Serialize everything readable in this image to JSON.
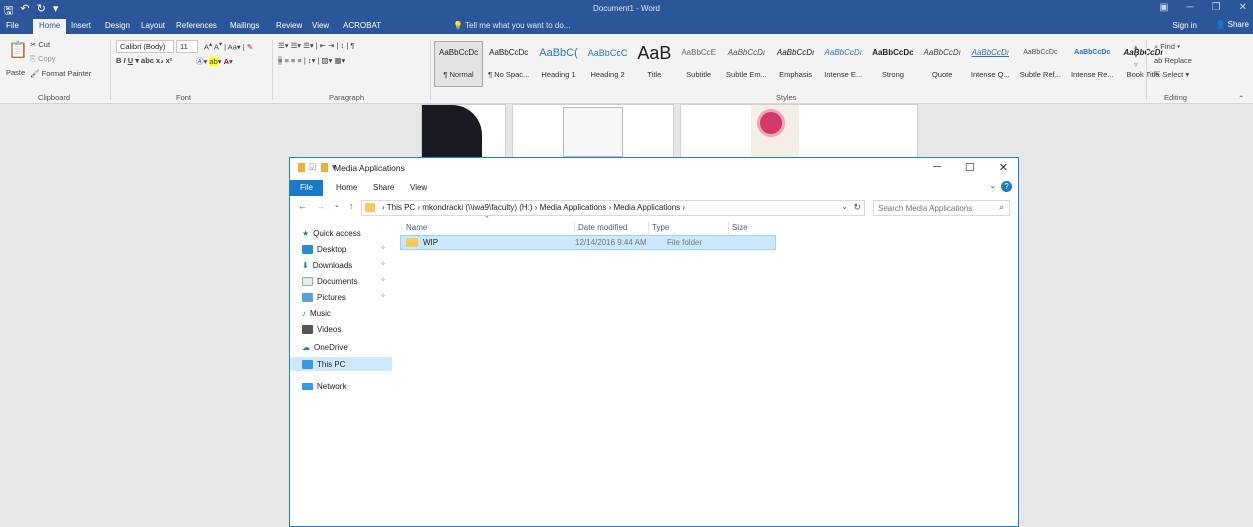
{
  "word": {
    "qat": [
      "save-icon",
      "undo-icon",
      "redo-icon",
      "customize-icon"
    ],
    "doc_title": "Document1 - Word",
    "tabs": [
      "File",
      "Home",
      "Insert",
      "Design",
      "Layout",
      "References",
      "Mailings",
      "Review",
      "View",
      "ACROBAT"
    ],
    "active_tab": "Home",
    "tell_me": "Tell me what you want to do...",
    "sign_in": "Sign in",
    "share": "Share",
    "ribbon": {
      "clipboard": {
        "paste": "Paste",
        "cut": "Cut",
        "copy": "Copy",
        "format_painter": "Format Painter",
        "label": "Clipboard"
      },
      "font": {
        "family": "Calibri (Body)",
        "size": "11",
        "label": "Font"
      },
      "paragraph": {
        "label": "Paragraph"
      },
      "styles": {
        "label": "Styles",
        "items": [
          {
            "sample": "AaBbCcDc",
            "name": "¶ Normal"
          },
          {
            "sample": "AaBbCcDc",
            "name": "¶ No Spac..."
          },
          {
            "sample": "AaBbC(",
            "name": "Heading 1"
          },
          {
            "sample": "AaBbCcC",
            "name": "Heading 2"
          },
          {
            "sample": "AaB",
            "name": "Title"
          },
          {
            "sample": "AaBbCcE",
            "name": "Subtitle"
          },
          {
            "sample": "AaBbCcDı",
            "name": "Subtle Em..."
          },
          {
            "sample": "AaBbCcDı",
            "name": "Emphasis"
          },
          {
            "sample": "AaBbCcDı",
            "name": "Intense E..."
          },
          {
            "sample": "AaBbCcDc",
            "name": "Strong"
          },
          {
            "sample": "AaBbCcDı",
            "name": "Quote"
          },
          {
            "sample": "AaBbCcDı",
            "name": "Intense Q..."
          },
          {
            "sample": "AaBbCcDc",
            "name": "Subtle Ref..."
          },
          {
            "sample": "AaBbCcDc",
            "name": "Intense Re..."
          },
          {
            "sample": "AaBbCcDı",
            "name": "Book Title"
          }
        ]
      },
      "editing": {
        "find": "Find",
        "replace": "Replace",
        "select": "Select",
        "label": "Editing"
      }
    }
  },
  "explorer": {
    "title": "Media Applications",
    "tabs": [
      "Home",
      "Share",
      "View"
    ],
    "file_tab": "File",
    "address": "› This PC › mkondracki (\\\\iwa9\\faculty) (H:) › Media Applications › Media Applications ›",
    "search_placeholder": "Search Media Applications",
    "nav": [
      {
        "label": "Quick access",
        "icon": "star-icon",
        "pinned": false
      },
      {
        "label": "Desktop",
        "icon": "desktop-icon",
        "pinned": true
      },
      {
        "label": "Downloads",
        "icon": "download-icon",
        "pinned": true
      },
      {
        "label": "Documents",
        "icon": "documents-icon",
        "pinned": true
      },
      {
        "label": "Pictures",
        "icon": "pictures-icon",
        "pinned": true
      },
      {
        "label": "Music",
        "icon": "music-icon",
        "pinned": false
      },
      {
        "label": "Videos",
        "icon": "videos-icon",
        "pinned": false
      },
      {
        "label": "OneDrive",
        "icon": "cloud-icon",
        "pinned": false
      },
      {
        "label": "This PC",
        "icon": "computer-icon",
        "pinned": false
      },
      {
        "label": "Network",
        "icon": "network-icon",
        "pinned": false
      }
    ],
    "selected_nav": "This PC",
    "columns": {
      "name": "Name",
      "date": "Date modified",
      "type": "Type",
      "size": "Size"
    },
    "files": [
      {
        "name": "WIP",
        "date": "12/14/2016 9:44 AM",
        "type": "File folder",
        "size": ""
      }
    ]
  }
}
